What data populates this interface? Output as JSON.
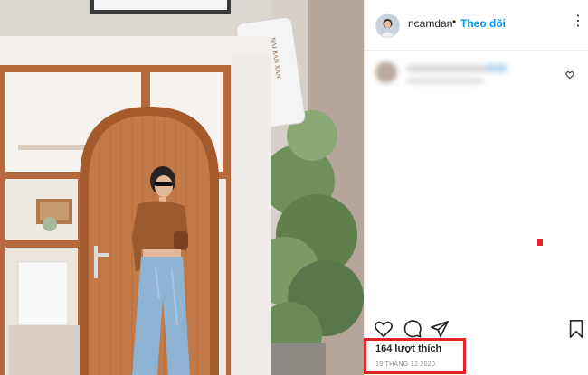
{
  "post": {
    "username": "ncamdan",
    "separator": "•",
    "follow_label": "Theo dõi",
    "more_label": "⋮",
    "likes_text": "164 lượt thích",
    "date_text": "19 THÁNG 12 2020",
    "shop_sign_text": "NAI BAN XAN"
  },
  "icons": {
    "heart": "heart-icon",
    "comment": "comment-icon",
    "share": "share-icon",
    "bookmark": "bookmark-icon"
  },
  "colors": {
    "link_blue": "#0095f6",
    "highlight_red": "#e0242a",
    "text_dark": "#262626",
    "text_muted": "#8e8e8e"
  }
}
